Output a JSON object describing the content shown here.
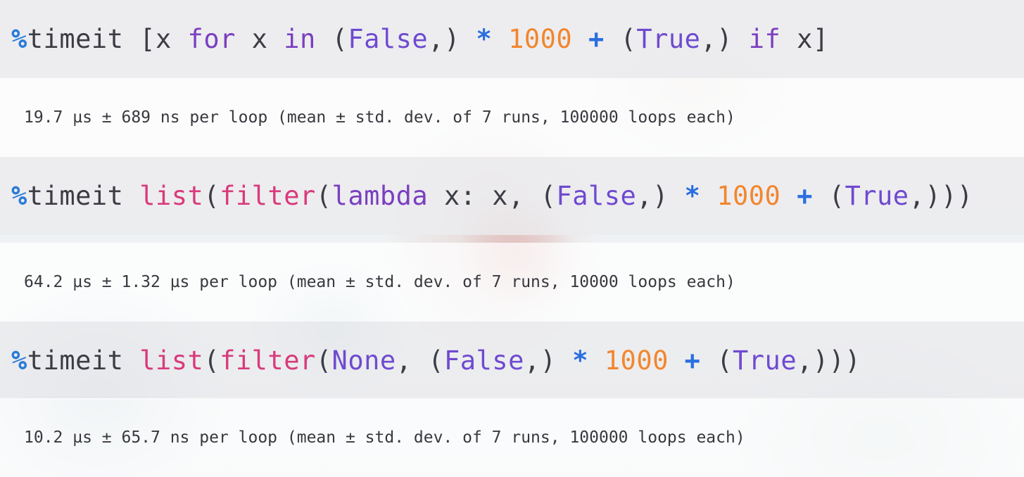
{
  "cells": [
    {
      "code_tokens": [
        {
          "t": "%",
          "k": "magic"
        },
        {
          "t": "timeit [x ",
          "k": "plain"
        },
        {
          "t": "for",
          "k": "kw"
        },
        {
          "t": " x ",
          "k": "plain"
        },
        {
          "t": "in",
          "k": "kw"
        },
        {
          "t": " (",
          "k": "plain"
        },
        {
          "t": "False",
          "k": "const"
        },
        {
          "t": ",) ",
          "k": "plain"
        },
        {
          "t": "*",
          "k": "op"
        },
        {
          "t": " ",
          "k": "plain"
        },
        {
          "t": "1000",
          "k": "num"
        },
        {
          "t": " ",
          "k": "plain"
        },
        {
          "t": "+",
          "k": "op"
        },
        {
          "t": " (",
          "k": "plain"
        },
        {
          "t": "True",
          "k": "const"
        },
        {
          "t": ",) ",
          "k": "plain"
        },
        {
          "t": "if",
          "k": "kw"
        },
        {
          "t": " x]",
          "k": "plain"
        }
      ],
      "output": "19.7 µs ± 689 ns per loop (mean ± std. dev. of 7 runs, 100000 loops each)"
    },
    {
      "code_tokens": [
        {
          "t": "%",
          "k": "magic"
        },
        {
          "t": "timeit ",
          "k": "plain"
        },
        {
          "t": "list",
          "k": "fn"
        },
        {
          "t": "(",
          "k": "plain"
        },
        {
          "t": "filter",
          "k": "fn"
        },
        {
          "t": "(",
          "k": "plain"
        },
        {
          "t": "lambda",
          "k": "kw"
        },
        {
          "t": " x: x, (",
          "k": "plain"
        },
        {
          "t": "False",
          "k": "const"
        },
        {
          "t": ",) ",
          "k": "plain"
        },
        {
          "t": "*",
          "k": "op"
        },
        {
          "t": " ",
          "k": "plain"
        },
        {
          "t": "1000",
          "k": "num"
        },
        {
          "t": " ",
          "k": "plain"
        },
        {
          "t": "+",
          "k": "op"
        },
        {
          "t": " (",
          "k": "plain"
        },
        {
          "t": "True",
          "k": "const"
        },
        {
          "t": ",)))",
          "k": "plain"
        }
      ],
      "output": "64.2 µs ± 1.32 µs per loop (mean ± std. dev. of 7 runs, 10000 loops each)"
    },
    {
      "code_tokens": [
        {
          "t": "%",
          "k": "magic"
        },
        {
          "t": "timeit ",
          "k": "plain"
        },
        {
          "t": "list",
          "k": "fn"
        },
        {
          "t": "(",
          "k": "plain"
        },
        {
          "t": "filter",
          "k": "fn"
        },
        {
          "t": "(",
          "k": "plain"
        },
        {
          "t": "None",
          "k": "const"
        },
        {
          "t": ", (",
          "k": "plain"
        },
        {
          "t": "False",
          "k": "const"
        },
        {
          "t": ",) ",
          "k": "plain"
        },
        {
          "t": "*",
          "k": "op"
        },
        {
          "t": " ",
          "k": "plain"
        },
        {
          "t": "1000",
          "k": "num"
        },
        {
          "t": " ",
          "k": "plain"
        },
        {
          "t": "+",
          "k": "op"
        },
        {
          "t": " (",
          "k": "plain"
        },
        {
          "t": "True",
          "k": "const"
        },
        {
          "t": ",)))",
          "k": "plain"
        }
      ],
      "output": "10.2 µs ± 65.7 ns per loop (mean ± std. dev. of 7 runs, 100000 loops each)"
    }
  ]
}
